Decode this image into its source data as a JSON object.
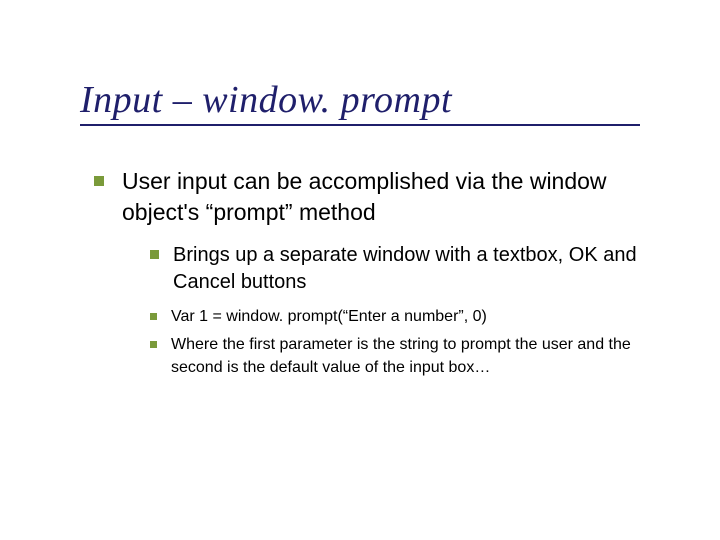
{
  "title": "Input – window. prompt",
  "bullets": {
    "level1": "User input can be accomplished via the window object's “prompt” method",
    "level2": "Brings up a separate window with a textbox, OK and Cancel buttons",
    "level3a": "Var 1 = window. prompt(“Enter a number”, 0)",
    "level3b": "Where the first parameter is the string to prompt the user and the second is the default value of the input box…"
  }
}
